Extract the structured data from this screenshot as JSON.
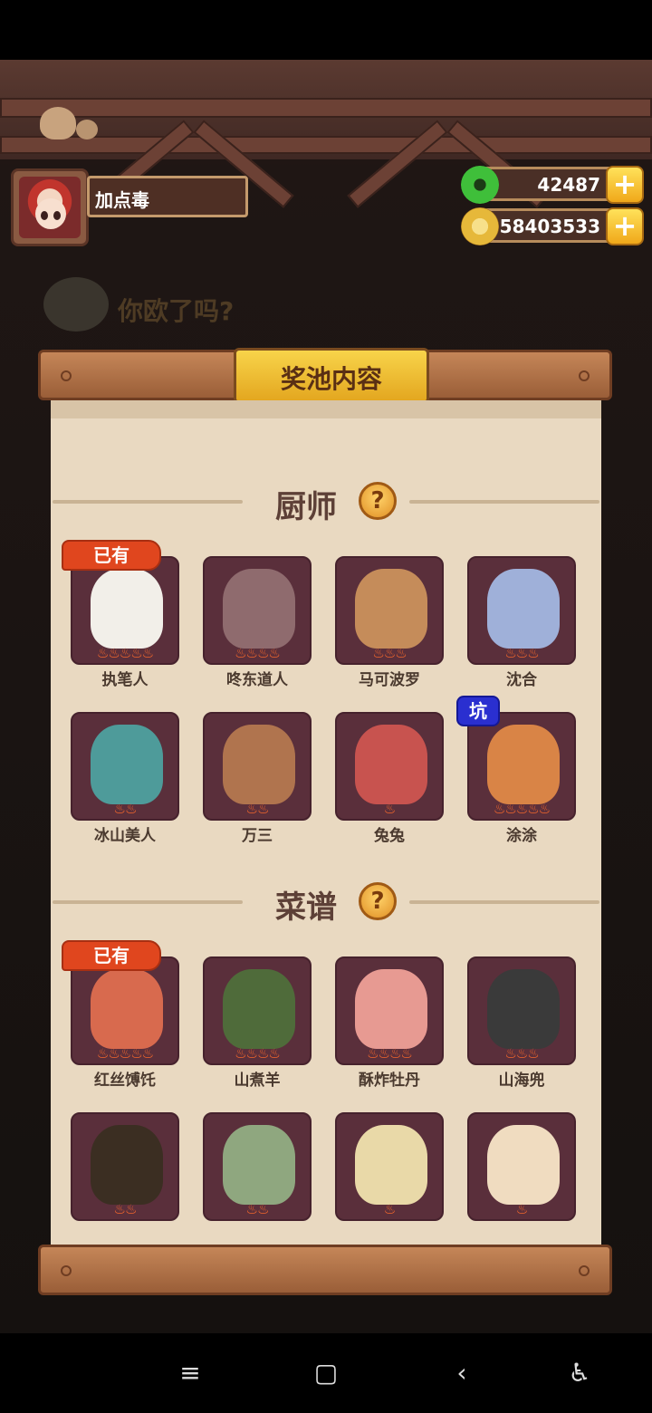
{
  "player": {
    "name": "加点毒",
    "jade": "42487",
    "coins": "58403533"
  },
  "background": {
    "caption": "你欧了吗?"
  },
  "modal": {
    "title": "奖池内容",
    "sections": {
      "chefs": {
        "title": "厨师",
        "help": "?"
      },
      "recipes": {
        "title": "菜谱",
        "help": "?"
      }
    }
  },
  "badges": {
    "owned": "已有",
    "pit": "坑"
  },
  "chefs": [
    {
      "name": "执笔人",
      "stars": 5,
      "art_color": "#f2efe9",
      "badge": "owned"
    },
    {
      "name": "咚东道人",
      "stars": 4,
      "art_color": "#8f6b6e",
      "badge": ""
    },
    {
      "name": "马可波罗",
      "stars": 3,
      "art_color": "#c58c5a",
      "badge": ""
    },
    {
      "name": "沈合",
      "stars": 3,
      "art_color": "#9fb0d9",
      "badge": ""
    },
    {
      "name": "冰山美人",
      "stars": 2,
      "art_color": "#4e9b9a",
      "badge": ""
    },
    {
      "name": "万三",
      "stars": 2,
      "art_color": "#b0744e",
      "badge": ""
    },
    {
      "name": "兔兔",
      "stars": 1,
      "art_color": "#c8534f",
      "badge": ""
    },
    {
      "name": "涂涂",
      "stars": 5,
      "art_color": "#d98446",
      "badge": "pit"
    }
  ],
  "recipes": [
    {
      "name": "红丝馎饦",
      "stars": 5,
      "art_color": "#d86a4e",
      "badge": "owned"
    },
    {
      "name": "山煮羊",
      "stars": 4,
      "art_color": "#4f6b3a",
      "badge": ""
    },
    {
      "name": "酥炸牡丹",
      "stars": 4,
      "art_color": "#e79a92",
      "badge": ""
    },
    {
      "name": "山海兜",
      "stars": 3,
      "art_color": "#3a3a3a",
      "badge": ""
    },
    {
      "name": "",
      "stars": 2,
      "art_color": "#3b2e22",
      "badge": ""
    },
    {
      "name": "",
      "stars": 2,
      "art_color": "#8fa77f",
      "badge": ""
    },
    {
      "name": "",
      "stars": 1,
      "art_color": "#e9d9a8",
      "badge": ""
    },
    {
      "name": "",
      "stars": 1,
      "art_color": "#f0dcc0",
      "badge": ""
    }
  ],
  "nav": {
    "menu": "≡",
    "home": "▢",
    "back": "‹",
    "accessibility": "♿"
  }
}
